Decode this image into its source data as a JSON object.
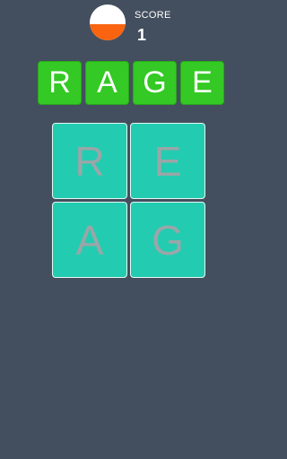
{
  "timer": {
    "remaining_fraction": 0.45,
    "fill_color": "#fa6410",
    "empty_color": "#ffffff"
  },
  "score": {
    "label": "SCORE",
    "value": "1"
  },
  "answer": [
    "R",
    "A",
    "G",
    "E"
  ],
  "tiles": [
    "R",
    "E",
    "A",
    "G"
  ],
  "colors": {
    "background": "#434f5e",
    "answer_tile": "#34c924",
    "grid_tile": "#23ccb1",
    "grid_text": "#9aa6a8"
  }
}
